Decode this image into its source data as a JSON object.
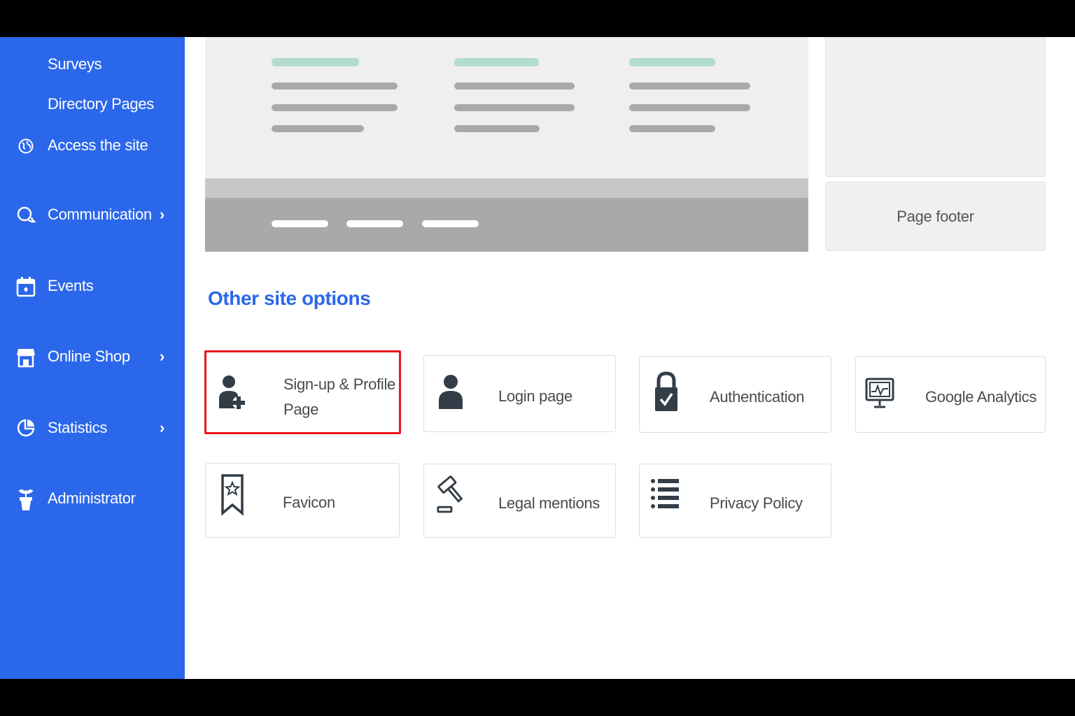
{
  "sidebar": {
    "sub_items": [
      {
        "label": "Surveys"
      },
      {
        "label": "Directory Pages"
      }
    ],
    "items": [
      {
        "label": "Access the site",
        "icon": "globe-icon",
        "has_submenu": false
      },
      {
        "label": "Communication",
        "icon": "chat-icon",
        "has_submenu": true
      },
      {
        "label": "Events",
        "icon": "calendar-icon",
        "has_submenu": false
      },
      {
        "label": "Online Shop",
        "icon": "shop-icon",
        "has_submenu": true
      },
      {
        "label": "Statistics",
        "icon": "pie-chart-icon",
        "has_submenu": true
      },
      {
        "label": "Administrator",
        "icon": "plant-icon",
        "has_submenu": false
      }
    ],
    "chevron": "›"
  },
  "preview": {
    "footer_label": "Page footer"
  },
  "options": {
    "title": "Other site options",
    "cards": [
      {
        "label": "Sign-up & Profile Page",
        "icon": "user-plus-icon",
        "highlighted": true
      },
      {
        "label": "Login page",
        "icon": "user-icon",
        "highlighted": false
      },
      {
        "label": "Authentication",
        "icon": "padlock-check-icon",
        "highlighted": false
      },
      {
        "label": "Google Analytics",
        "icon": "monitor-chart-icon",
        "highlighted": false
      },
      {
        "label": "Favicon",
        "icon": "bookmark-star-icon",
        "highlighted": false
      },
      {
        "label": "Legal mentions",
        "icon": "gavel-icon",
        "highlighted": false
      },
      {
        "label": "Privacy Policy",
        "icon": "list-icon",
        "highlighted": false
      }
    ]
  },
  "colors": {
    "sidebar_bg": "#2b67ea",
    "accent": "#2b67ea",
    "highlight_border": "#e8141f",
    "icon_dark": "#333d47"
  }
}
